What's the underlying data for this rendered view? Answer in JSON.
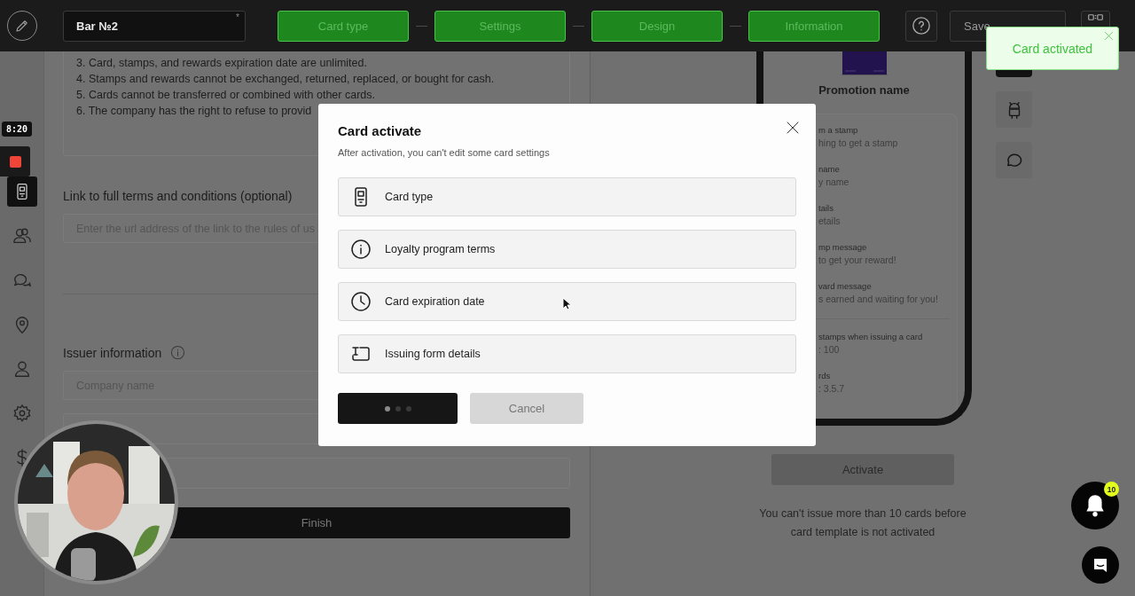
{
  "header": {
    "title_field": {
      "value": "Bar №2",
      "required_mark": "*"
    },
    "steps": [
      {
        "label": "Card type",
        "done": true
      },
      {
        "label": "Settings",
        "done": true
      },
      {
        "label": "Design",
        "done": true
      },
      {
        "label": "Information",
        "done": true
      }
    ],
    "save_button": "Save"
  },
  "recorder": {
    "time": "8:20"
  },
  "sidebar": {
    "items": [
      {
        "kind": "card",
        "selected": true
      },
      {
        "kind": "people",
        "selected": false
      },
      {
        "kind": "chat",
        "selected": false
      },
      {
        "kind": "pin",
        "selected": false
      },
      {
        "kind": "person",
        "selected": false
      },
      {
        "kind": "gear",
        "selected": false
      },
      {
        "kind": "dollar",
        "selected": false
      }
    ]
  },
  "form": {
    "terms_lines": [
      "3. Card, stamps, and rewards expiration date are unlimited.",
      "4. Stamps and rewards cannot be exchanged, returned, replaced, or bought for cash.",
      "5. Cards cannot be transferred or combined with other cards.",
      "6. The company has the right to refuse to provid"
    ],
    "link_label": "Link to full terms and conditions (optional)",
    "link_placeholder": "Enter the url address of the link to the rules of us",
    "issuer_title": "Issuer information",
    "company_placeholder": "Company name",
    "finish_button": "Finish"
  },
  "preview": {
    "promotion_name": "Promotion name",
    "fields": [
      {
        "label": "m a stamp",
        "value": "hing to get a stamp"
      },
      {
        "label": "name",
        "value": "y name"
      },
      {
        "label": "tails",
        "value": "etails"
      },
      {
        "label": "mp message",
        "value": "to get your reward!"
      },
      {
        "label": "vard message",
        "value": "s earned and waiting for you!"
      }
    ],
    "fields_2": [
      {
        "label": "stamps when issuing a card",
        "value": ": 100"
      },
      {
        "label": "rds",
        "value": ": 3.5.7"
      }
    ],
    "activate_button": "Activate",
    "notice": "You can't issue more than 10 cards before card template is not activated"
  },
  "modal": {
    "title": "Card activate",
    "subtitle": "After activation, you can't edit some card settings",
    "items": [
      {
        "kind": "card",
        "label": "Card type"
      },
      {
        "kind": "info",
        "label": "Loyalty program terms"
      },
      {
        "kind": "clock",
        "label": "Card expiration date"
      },
      {
        "kind": "form",
        "label": "Issuing form details"
      }
    ],
    "confirm_loading": true,
    "cancel_button": "Cancel"
  },
  "toast": {
    "text": "Card activated"
  },
  "notifications": {
    "count": "10"
  }
}
